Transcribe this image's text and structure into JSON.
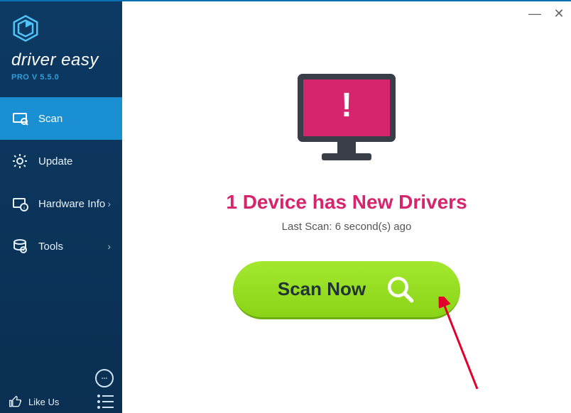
{
  "brand": {
    "name": "driver easy",
    "sub": "PRO V 5.5.0"
  },
  "sidebar": {
    "items": [
      {
        "label": "Scan",
        "icon": "scan-icon",
        "active": true,
        "arrow": false
      },
      {
        "label": "Update",
        "icon": "gear-icon",
        "active": false,
        "arrow": false
      },
      {
        "label": "Hardware Info",
        "icon": "hardware-icon",
        "active": false,
        "arrow": true
      },
      {
        "label": "Tools",
        "icon": "tools-icon",
        "active": false,
        "arrow": true
      }
    ],
    "like_label": "Like Us"
  },
  "main": {
    "headline": "1 Device has New Drivers",
    "last_scan_prefix": "Last Scan:",
    "last_scan_value": "6 second(s) ago",
    "scan_button": "Scan Now"
  },
  "titlebar": {
    "minimize": "—",
    "close": "✕"
  }
}
